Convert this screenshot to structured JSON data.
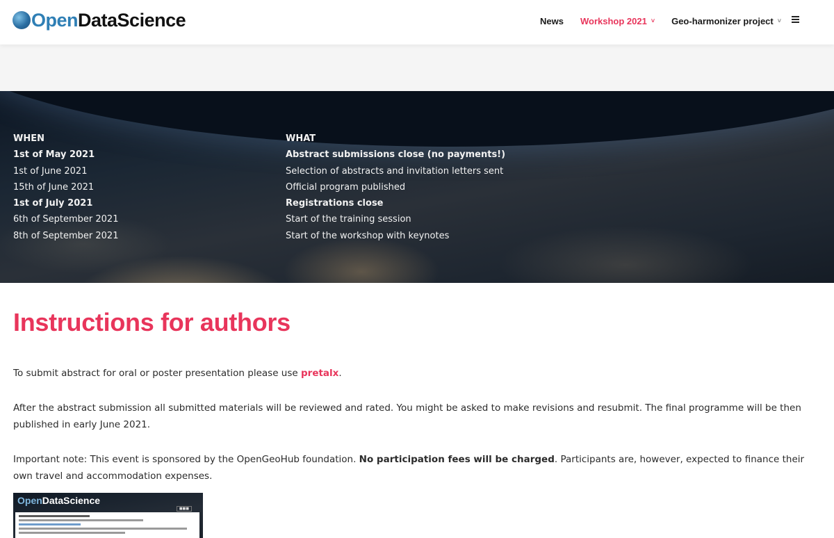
{
  "header": {
    "logo": {
      "open": "Open",
      "rest": "DataScience"
    },
    "nav": [
      {
        "label": "News",
        "active": false,
        "dropdown": false
      },
      {
        "label": "Workshop 2021",
        "active": true,
        "dropdown": true
      },
      {
        "label": "Geo-harmonizer project",
        "active": false,
        "dropdown": true
      }
    ],
    "menu_icon": "hamburger-icon",
    "chevron": "˅"
  },
  "schedule": {
    "when_header": "WHEN",
    "what_header": "WHAT",
    "rows": [
      {
        "when": "1st of May 2021",
        "what": "Abstract submissions close (no payments!)",
        "bold": true
      },
      {
        "when": "1st of June 2021",
        "what": "Selection of abstracts and invitation letters sent",
        "bold": false
      },
      {
        "when": "15th of June 2021",
        "what": "Official program published",
        "bold": false
      },
      {
        "when": "1st of July 2021",
        "what": "Registrations close",
        "bold": true
      },
      {
        "when": "6th of September 2021",
        "what": "Start of the training session",
        "bold": false
      },
      {
        "when": "8th of September 2021",
        "what": "Start of the workshop with keynotes",
        "bold": false
      }
    ]
  },
  "main": {
    "title": "Instructions for authors",
    "p1_before": "To submit abstract for oral or poster presentation please use ",
    "p1_link": "pretalx",
    "p1_after": ".",
    "p2": "After the abstract submission all submitted materials will be reviewed and rated. You might be asked to make revisions and resubmit. The final programme will be then published in early June 2021.",
    "p3_before": "Important note: This event is sponsored by the OpenGeoHub foundation. ",
    "p3_bold": "No participation fees will be charged",
    "p3_after": ". Participants are, however, expected to finance their own travel and accommodation expenses."
  },
  "thumbnail": {
    "logo_open": "Open",
    "logo_rest": "DataScience"
  },
  "colors": {
    "accent": "#e8355b",
    "logo_blue": "#2f7fb5"
  }
}
